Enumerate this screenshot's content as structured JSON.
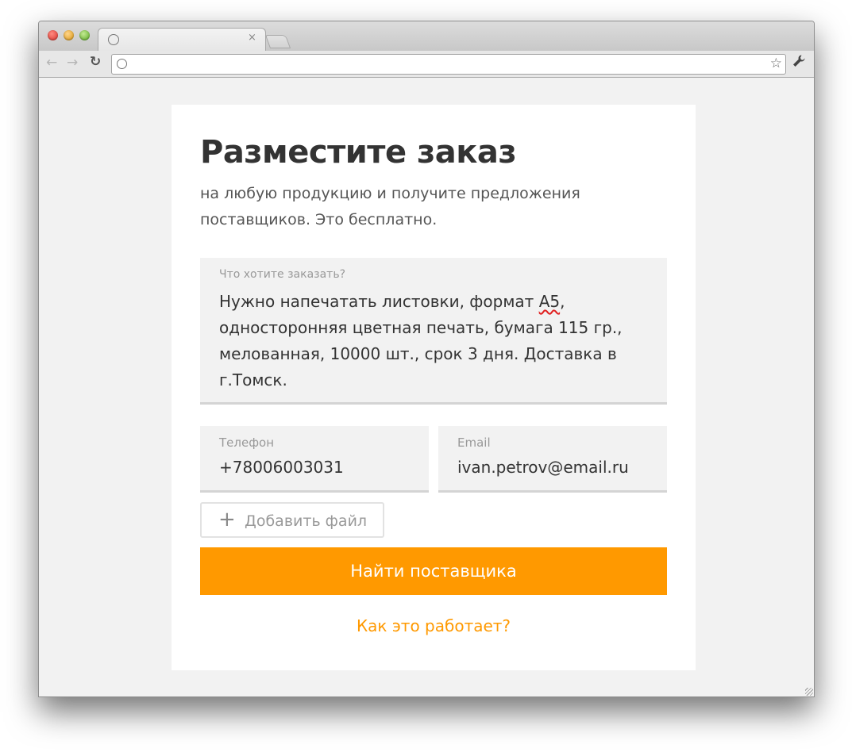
{
  "browser": {
    "address": "",
    "tab_close": "×"
  },
  "icons": {
    "back": "←",
    "forward": "→",
    "reload": "↻",
    "star": "☆",
    "wrench": "🔧",
    "plus": "+"
  },
  "form": {
    "title": "Разместите заказ",
    "subtitle": "на любую продукцию и получите предложения поставщиков. Это бесплатно.",
    "order": {
      "label": "Что хотите заказать?",
      "value_before": "Нужно напечатать листовки, формат ",
      "value_misspelled": "А5",
      "value_after": ", односторонняя цветная печать, бумага 115 гр., мелованная, 10000 шт., срок 3 дня. Доставка в г.Томск."
    },
    "phone": {
      "label": "Телефон",
      "value": "+78006003031"
    },
    "email": {
      "label": "Email",
      "value": "ivan.petrov@email.ru"
    },
    "add_file_label": "Добавить файл",
    "submit_label": "Найти поставщика",
    "how_link": "Как это работает?"
  },
  "colors": {
    "accent": "#ff9900",
    "title": "#333333",
    "field_bg": "#f2f2f2"
  }
}
